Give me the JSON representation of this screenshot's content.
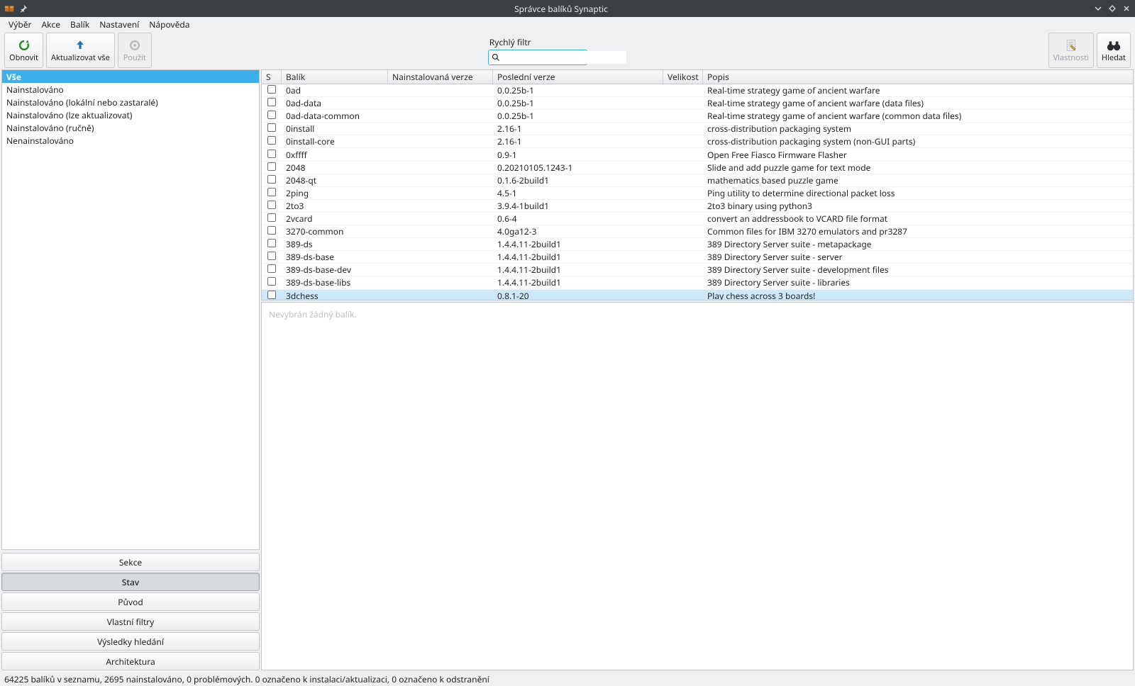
{
  "titlebar": {
    "title": "Správce balíků Synaptic",
    "pin_tooltip": "pin"
  },
  "menubar": {
    "items": [
      "Výběr",
      "Akce",
      "Balík",
      "Nastavení",
      "Nápověda"
    ]
  },
  "toolbar": {
    "reload_label": "Obnovit",
    "upgrade_all_label": "Aktualizovat vše",
    "apply_label": "Použít",
    "properties_label": "Vlastnosti",
    "search_label": "Hledat"
  },
  "quickfilter": {
    "label": "Rychlý filtr",
    "value": "",
    "placeholder": ""
  },
  "sidebar": {
    "categories": [
      {
        "label": "Vše",
        "selected": true
      },
      {
        "label": "Nainstalováno",
        "selected": false
      },
      {
        "label": "Nainstalováno (lokální nebo zastaralé)",
        "selected": false
      },
      {
        "label": "Nainstalováno (lze aktualizovat)",
        "selected": false
      },
      {
        "label": "Nainstalováno (ručně)",
        "selected": false
      },
      {
        "label": "Nenainstalováno",
        "selected": false
      }
    ],
    "views": [
      {
        "label": "Sekce",
        "active": false
      },
      {
        "label": "Stav",
        "active": true
      },
      {
        "label": "Původ",
        "active": false
      },
      {
        "label": "Vlastní filtry",
        "active": false
      },
      {
        "label": "Výsledky hledání",
        "active": false
      },
      {
        "label": "Architektura",
        "active": false
      }
    ]
  },
  "table": {
    "columns": {
      "s": "S",
      "package": "Balík",
      "installed_version": "Nainstalovaná verze",
      "latest_version": "Poslední verze",
      "size": "Velikost",
      "description": "Popis"
    },
    "rows": [
      {
        "pkg": "0ad",
        "iv": "",
        "lv": "0.0.25b-1",
        "sz": "",
        "desc": "Real-time strategy game of ancient warfare",
        "hl": false
      },
      {
        "pkg": "0ad-data",
        "iv": "",
        "lv": "0.0.25b-1",
        "sz": "",
        "desc": "Real-time strategy game of ancient warfare (data files)",
        "hl": false
      },
      {
        "pkg": "0ad-data-common",
        "iv": "",
        "lv": "0.0.25b-1",
        "sz": "",
        "desc": "Real-time strategy game of ancient warfare (common data files)",
        "hl": false
      },
      {
        "pkg": "0install",
        "iv": "",
        "lv": "2.16-1",
        "sz": "",
        "desc": "cross-distribution packaging system",
        "hl": false
      },
      {
        "pkg": "0install-core",
        "iv": "",
        "lv": "2.16-1",
        "sz": "",
        "desc": "cross-distribution packaging system (non-GUI parts)",
        "hl": false
      },
      {
        "pkg": "0xffff",
        "iv": "",
        "lv": "0.9-1",
        "sz": "",
        "desc": "Open Free Fiasco Firmware Flasher",
        "hl": false
      },
      {
        "pkg": "2048",
        "iv": "",
        "lv": "0.20210105.1243-1",
        "sz": "",
        "desc": "Slide and add puzzle game for text mode",
        "hl": false
      },
      {
        "pkg": "2048-qt",
        "iv": "",
        "lv": "0.1.6-2build1",
        "sz": "",
        "desc": "mathematics based puzzle game",
        "hl": false
      },
      {
        "pkg": "2ping",
        "iv": "",
        "lv": "4.5-1",
        "sz": "",
        "desc": "Ping utility to determine directional packet loss",
        "hl": false
      },
      {
        "pkg": "2to3",
        "iv": "",
        "lv": "3.9.4-1build1",
        "sz": "",
        "desc": "2to3 binary using python3",
        "hl": false
      },
      {
        "pkg": "2vcard",
        "iv": "",
        "lv": "0.6-4",
        "sz": "",
        "desc": "convert an addressbook to VCARD file format",
        "hl": false
      },
      {
        "pkg": "3270-common",
        "iv": "",
        "lv": "4.0ga12-3",
        "sz": "",
        "desc": "Common files for IBM 3270 emulators and pr3287",
        "hl": false
      },
      {
        "pkg": "389-ds",
        "iv": "",
        "lv": "1.4.4.11-2build1",
        "sz": "",
        "desc": "389 Directory Server suite - metapackage",
        "hl": false
      },
      {
        "pkg": "389-ds-base",
        "iv": "",
        "lv": "1.4.4.11-2build1",
        "sz": "",
        "desc": "389 Directory Server suite - server",
        "hl": false
      },
      {
        "pkg": "389-ds-base-dev",
        "iv": "",
        "lv": "1.4.4.11-2build1",
        "sz": "",
        "desc": "389 Directory Server suite - development files",
        "hl": false
      },
      {
        "pkg": "389-ds-base-libs",
        "iv": "",
        "lv": "1.4.4.11-2build1",
        "sz": "",
        "desc": "389 Directory Server suite - libraries",
        "hl": false
      },
      {
        "pkg": "3dchess",
        "iv": "",
        "lv": "0.8.1-20",
        "sz": "",
        "desc": "Play chess across 3 boards!",
        "hl": true
      }
    ]
  },
  "detail": {
    "placeholder": "Nevybrán žádný balík."
  },
  "statusbar": {
    "text": "64225 balíků v seznamu, 2695 nainstalováno, 0 problémových. 0 označeno k instalaci/aktualizaci, 0 označeno k odstranění"
  }
}
